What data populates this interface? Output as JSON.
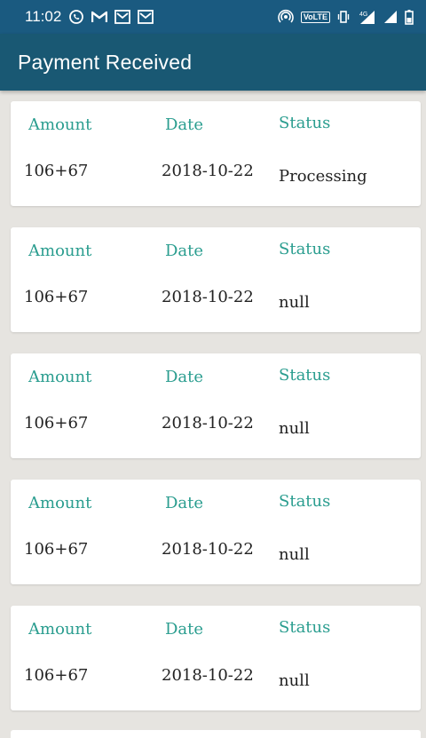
{
  "status_bar": {
    "time": "11:02",
    "left_icons": [
      "whatsapp-icon",
      "gmail-icon",
      "mail-icon",
      "mail-icon"
    ],
    "volte": "VoLTE",
    "network": "4G"
  },
  "app_bar": {
    "title": "Payment Received",
    "color": "#195873"
  },
  "labels": {
    "amount": "Amount",
    "date": "Date",
    "status": "Status"
  },
  "payments": [
    {
      "amount": "106+67",
      "date": "2018-10-22",
      "status": "Processing"
    },
    {
      "amount": "106+67",
      "date": "2018-10-22",
      "status": "null"
    },
    {
      "amount": "106+67",
      "date": "2018-10-22",
      "status": "null"
    },
    {
      "amount": "106+67",
      "date": "2018-10-22",
      "status": "null"
    },
    {
      "amount": "106+67",
      "date": "2018-10-22",
      "status": "null"
    }
  ],
  "colors": {
    "label": "#2a9d8f",
    "background": "#e6e4e0"
  }
}
